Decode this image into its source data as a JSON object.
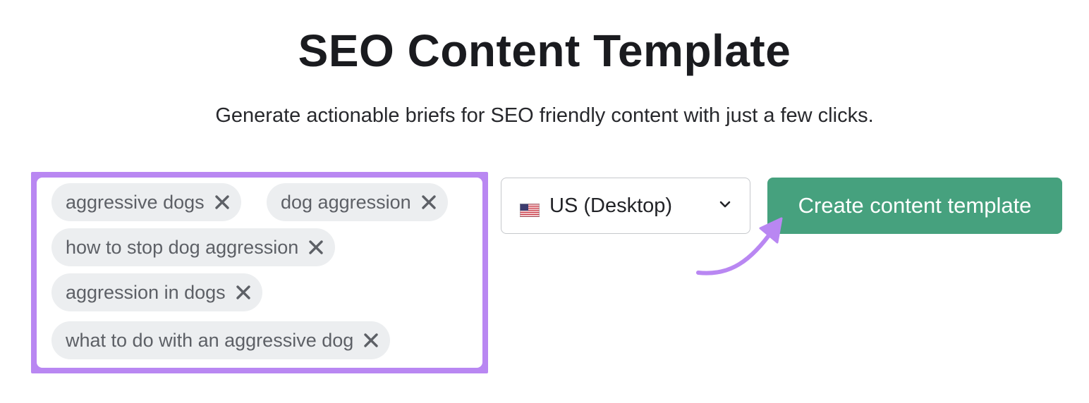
{
  "header": {
    "title": "SEO Content Template",
    "subtitle": "Generate actionable briefs for SEO friendly content with just a few clicks."
  },
  "keywords": {
    "tags": [
      "aggressive dogs",
      "dog aggression",
      "how to stop dog aggression",
      "aggression in dogs",
      "what to do with an aggressive dog"
    ],
    "remove_icon": "close-icon"
  },
  "location": {
    "selected": "US (Desktop)",
    "flag_icon": "us-flag-icon",
    "dropdown_icon": "chevron-down-icon"
  },
  "actions": {
    "create_label": "Create content template"
  },
  "colors": {
    "highlight": "#b987f2",
    "button": "#46a17e",
    "tag_bg": "#eceef0",
    "arrow": "#b987f2"
  }
}
